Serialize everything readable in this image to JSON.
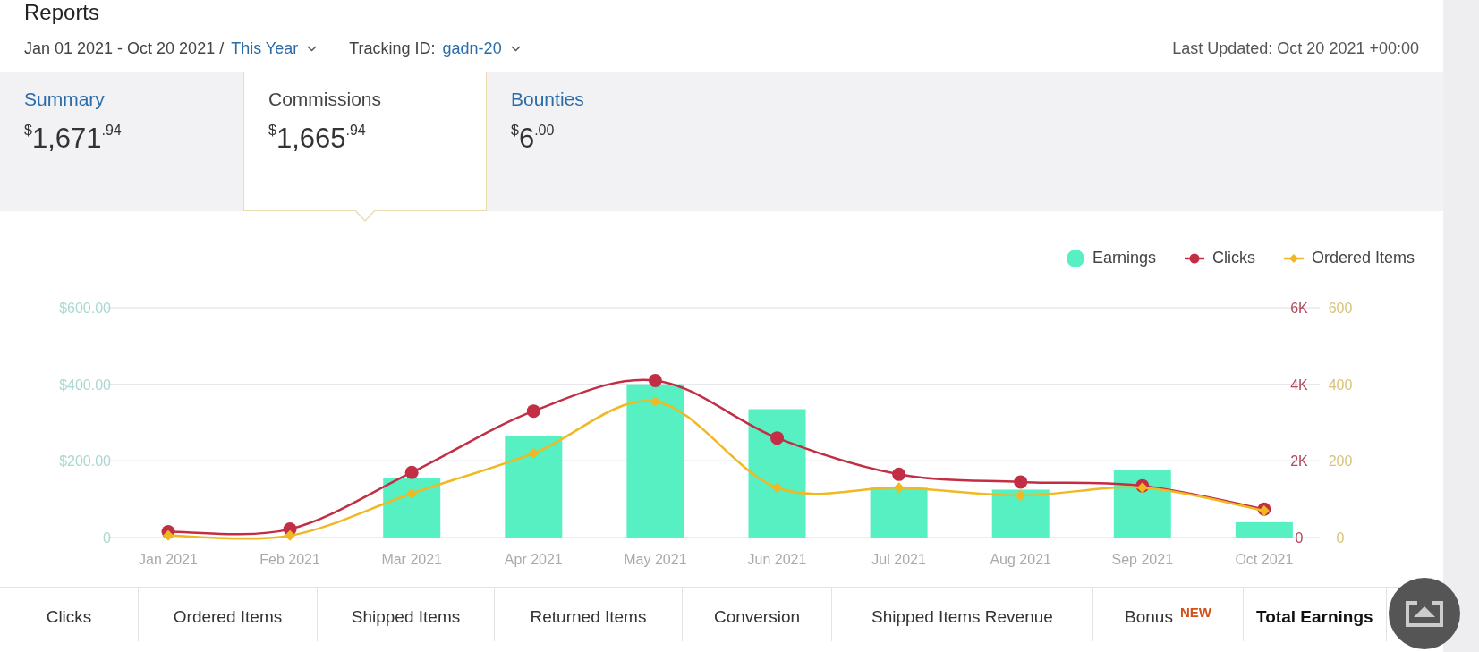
{
  "page": {
    "title": "Reports"
  },
  "filters": {
    "date_range": "Jan 01 2021 - Oct 20 2021 /",
    "period": "This Year",
    "tracking_label": "Tracking ID:",
    "tracking_id": "gadn-20",
    "last_updated": "Last Updated: Oct 20 2021 +00:00"
  },
  "summary_tabs": [
    {
      "label": "Summary",
      "currency": "$",
      "whole": "1,671",
      "cents": ".94",
      "selected": false
    },
    {
      "label": "Commissions",
      "currency": "$",
      "whole": "1,665",
      "cents": ".94",
      "selected": true
    },
    {
      "label": "Bounties",
      "currency": "$",
      "whole": "6",
      "cents": ".00",
      "selected": false
    }
  ],
  "chart": {
    "chart_data": {
      "type": "bar",
      "categories": [
        "Jan 2021",
        "Feb 2021",
        "Mar 2021",
        "Apr 2021",
        "May 2021",
        "Jun 2021",
        "Jul 2021",
        "Aug 2021",
        "Sep 2021",
        "Oct 2021"
      ],
      "legend": "top-right",
      "ylim": [
        0,
        600
      ],
      "y2lim": [
        0,
        6000
      ],
      "y2ticks": [
        {
          "value": 0,
          "label": "0"
        },
        {
          "value": 2000,
          "label": "2K"
        },
        {
          "value": 4000,
          "label": "4K"
        },
        {
          "value": 6000,
          "label": "6K"
        }
      ],
      "y3lim": [
        0,
        600
      ],
      "y3ticks": [
        {
          "value": 0,
          "label": "0"
        },
        {
          "value": 200,
          "label": "200"
        },
        {
          "value": 400,
          "label": "400"
        },
        {
          "value": 600,
          "label": "600"
        }
      ],
      "yticks": [
        {
          "value": 0,
          "label": "0"
        },
        {
          "value": 200,
          "label": "$200.00"
        },
        {
          "value": 400,
          "label": "$400.00"
        },
        {
          "value": 600,
          "label": "$600.00"
        }
      ],
      "series": [
        {
          "name": "Earnings",
          "color": "#56f0c2",
          "values": [
            0,
            0,
            155,
            265,
            400,
            335,
            130,
            125,
            175,
            40
          ]
        },
        {
          "name": "Clicks",
          "type": "line",
          "marker": "circle",
          "axis": "y2",
          "color": "#c22f45",
          "values": [
            150,
            220,
            1700,
            3300,
            4100,
            2600,
            1650,
            1450,
            1350,
            740
          ]
        },
        {
          "name": "Ordered Items",
          "type": "line",
          "marker": "diamond",
          "axis": "y3",
          "color": "#f0b923",
          "values": [
            5,
            5,
            115,
            220,
            355,
            130,
            130,
            110,
            130,
            70
          ]
        }
      ]
    }
  },
  "metric_tabs": [
    {
      "label": "Clicks",
      "selected": false
    },
    {
      "label": "Ordered Items",
      "selected": false
    },
    {
      "label": "Shipped Items",
      "selected": false
    },
    {
      "label": "Returned Items",
      "selected": false
    },
    {
      "label": "Conversion",
      "selected": false
    },
    {
      "label": "Shipped Items Revenue",
      "selected": false
    },
    {
      "label": "Bonus",
      "badge": "NEW",
      "selected": false
    },
    {
      "label": "Total Earnings",
      "selected": true
    }
  ]
}
